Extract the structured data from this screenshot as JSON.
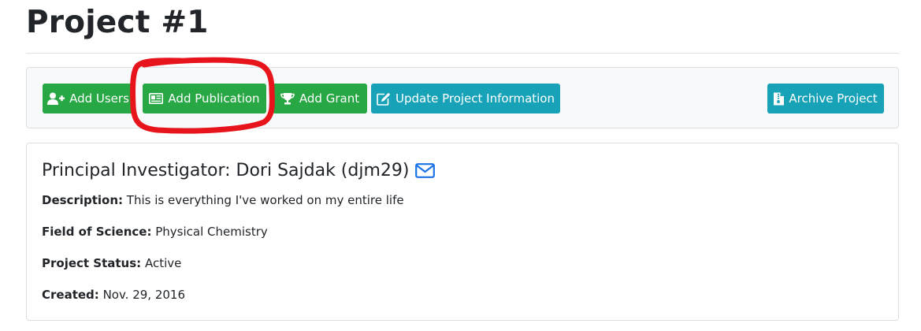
{
  "page": {
    "title": "Project #1"
  },
  "toolbar": {
    "add_users_label": "Add Users",
    "add_publication_label": "Add Publication",
    "add_grant_label": "Add Grant",
    "update_info_label": "Update Project Information",
    "archive_label": "Archive Project"
  },
  "details": {
    "pi_heading": "Principal Investigator: Dori Sajdak (djm29)",
    "description_label": "Description:",
    "description_value": "This is everything I've worked on my entire life",
    "field_label": "Field of Science:",
    "field_value": "Physical Chemistry",
    "status_label": "Project Status:",
    "status_value": "Active",
    "created_label": "Created:",
    "created_value": "Nov. 29, 2016"
  },
  "icons": {
    "add_users": "user-plus-icon",
    "add_publication": "newspaper-icon",
    "add_grant": "trophy-icon",
    "update_info": "edit-icon",
    "archive": "file-archive-icon",
    "pi_email": "envelope-icon"
  },
  "colors": {
    "success": "#28a745",
    "info": "#17a2b8",
    "link": "#1a73e8",
    "annotation": "#e8141c"
  }
}
